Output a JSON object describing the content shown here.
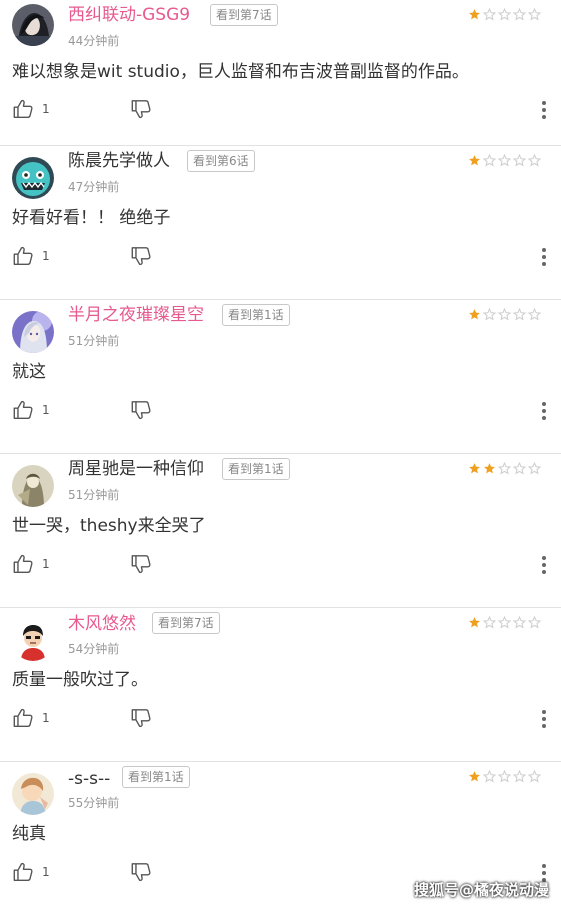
{
  "comments": [
    {
      "username": "西纠联动-GSG9",
      "name_color": "pink",
      "episode": "看到第7话",
      "rating": 1,
      "rating_max": 5,
      "time": "44分钟前",
      "text": "难以想象是wit  studio，巨人监督和布吉波普副监督的作品。",
      "likes": "1",
      "avatar": "avatar-dark-hair"
    },
    {
      "username": "陈晨先学做人",
      "name_color": "dark",
      "episode": "看到第6话",
      "rating": 1,
      "rating_max": 5,
      "time": "47分钟前",
      "text": "好看好看！！ 绝绝子",
      "likes": "1",
      "avatar": "avatar-teal-monster"
    },
    {
      "username": "半月之夜璀璨星空",
      "name_color": "pink",
      "episode": "看到第1话",
      "rating": 1,
      "rating_max": 5,
      "time": "51分钟前",
      "text": "就这",
      "likes": "1",
      "avatar": "avatar-anime-girl"
    },
    {
      "username": "周星驰是一种信仰",
      "name_color": "dark",
      "episode": "看到第1话",
      "rating": 2,
      "rating_max": 5,
      "time": "51分钟前",
      "text": "世一哭，theshy来全哭了",
      "likes": "1",
      "avatar": "avatar-sepia-figure"
    },
    {
      "username": "木风悠然",
      "name_color": "pink",
      "episode": "看到第7话",
      "rating": 1,
      "rating_max": 5,
      "time": "54分钟前",
      "text": "质量一般吹过了。",
      "likes": "1",
      "avatar": "avatar-cartoon-boy"
    },
    {
      "username": "-s-s--",
      "name_color": "dark",
      "episode": "看到第1话",
      "rating": 1,
      "rating_max": 5,
      "time": "55分钟前",
      "text": "纯真",
      "likes": "1",
      "avatar": "avatar-pastel-illustration"
    }
  ],
  "watermark": "搜狐号@橘夜说动漫",
  "colors": {
    "star_filled": "#f0a020",
    "star_empty": "#cfcfcf",
    "username_pink": "#e75a8f",
    "divider": "#e2e2e2"
  }
}
